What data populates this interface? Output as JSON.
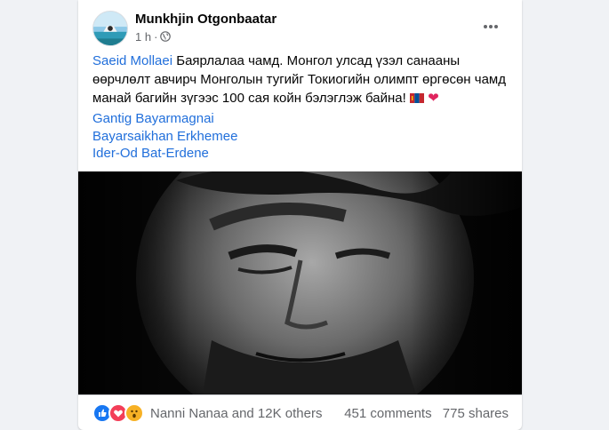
{
  "post": {
    "author": "Munkhjin Otgonbaatar",
    "time": "1 h",
    "separator": "·",
    "privacy_icon": "globe-icon",
    "more_icon": "more-options-icon",
    "message": {
      "mention": "Saeid Mollaei",
      "text": " Баярлалаа чамд. Монгол улсад үзэл санааны өөрчлөлт авчирч Монголын тугийг Токиогийн олимпт өргөсөн чамд манай багийн зүгээс 100 сая койн бэлэглэж байна! ",
      "emoji_flag": "mongolia-flag-icon",
      "emoji_heart": "❤"
    },
    "tags": [
      "Gantig Bayarmagnai",
      "Bayarsaikhan Erkhemee",
      "Ider-Od Bat-Erdene"
    ],
    "photo": "black-and-white close-up portrait photo of a man looking down",
    "reactions": {
      "icons": [
        "like-icon",
        "love-icon",
        "wow-icon"
      ],
      "summary": "Nanni Nanaa and 12K others",
      "comments": "451 comments",
      "shares": "775 shares"
    }
  },
  "colors": {
    "link": "#216fdb",
    "secondary_text": "#65676b",
    "like": "#1877f2",
    "love": "#f33e58",
    "wow": "#f7b125",
    "heart": "#e0245e"
  }
}
